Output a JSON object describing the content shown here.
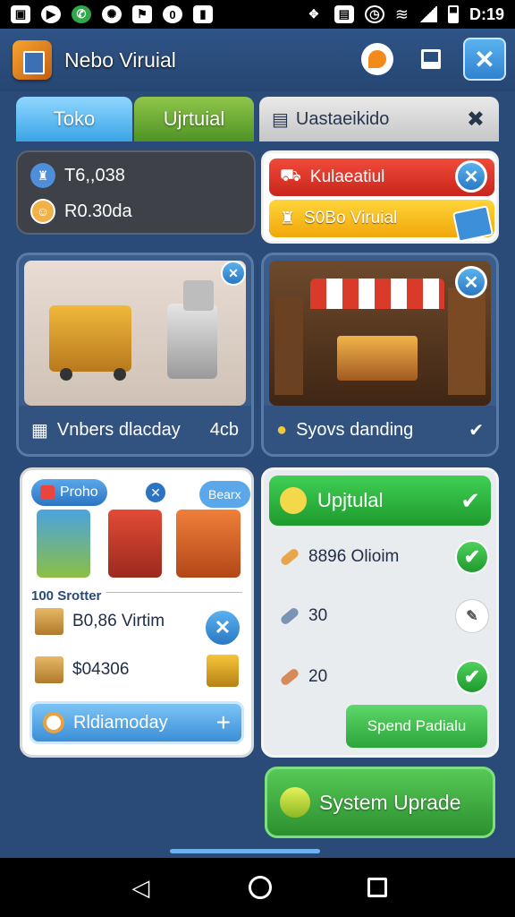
{
  "status_bar": {
    "time": "D:19",
    "left_icons": [
      "photo-icon",
      "play-icon",
      "whatsapp-icon",
      "settings-icon",
      "flag-icon",
      "o-icon",
      "media-icon"
    ],
    "right_icons": [
      "game-icon",
      "folder-icon",
      "alarm-icon",
      "wifi-icon",
      "signal-icon",
      "battery-icon"
    ]
  },
  "header": {
    "title": "Nebo Viruial"
  },
  "tabs": [
    {
      "label": "Toko"
    },
    {
      "label": "Ujrtuial"
    },
    {
      "label": "Uastaeikido"
    }
  ],
  "stats": {
    "primary": "T6,,038",
    "secondary": "R0.30da"
  },
  "alerts": [
    {
      "label": "Kulaeatiul"
    },
    {
      "label": "S0Bo Viruial"
    }
  ],
  "image_cards": [
    {
      "caption": "Vnbers dlacday",
      "value": "4cb"
    },
    {
      "caption": "Syovs danding"
    }
  ],
  "promo": {
    "pill": "Proho",
    "search": "Bearx",
    "section_label": "100 Srotter",
    "rows": [
      {
        "label": "B0,86 Virtim"
      },
      {
        "label": "$04306"
      }
    ],
    "button": "Rldiamoday"
  },
  "upgrade": {
    "banner": "Upjtulal",
    "rows": [
      {
        "value": "8896 Olioim"
      },
      {
        "value": "30"
      },
      {
        "value": "20"
      }
    ],
    "spend_button": "Spend Padialu"
  },
  "system_button": "System Uprade",
  "colors": {
    "background": "#2a4a77",
    "accent_blue": "#3ba5e6",
    "accent_green": "#2c8f2f",
    "alert_red": "#d62f22",
    "alert_yellow": "#f3b517"
  }
}
